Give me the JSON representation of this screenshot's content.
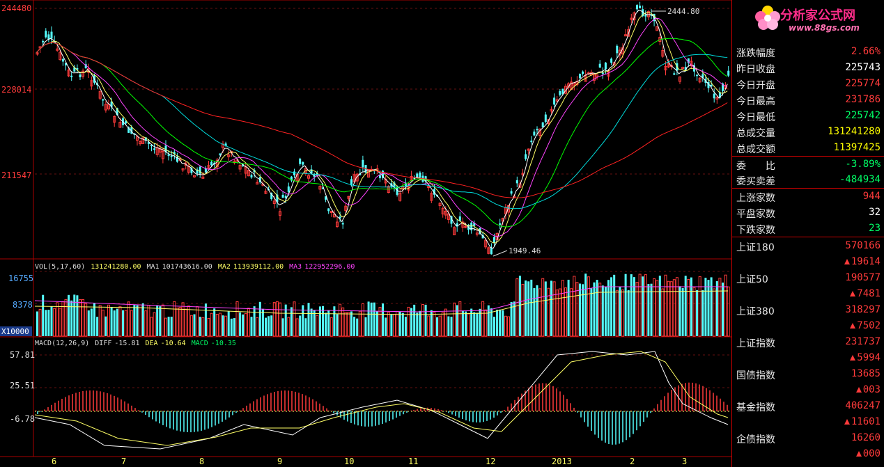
{
  "price_axis": [
    "244480",
    "228014",
    "211547"
  ],
  "vol_axis": [
    "16755",
    "8378",
    "X10000"
  ],
  "macd_axis": [
    "57.81",
    "25.51",
    "-6.78"
  ],
  "x_labels": [
    "6",
    "7",
    "8",
    "9",
    "10",
    "11",
    "12",
    "2013",
    "2",
    "3"
  ],
  "annotations": {
    "high": "2444.80",
    "low": "1949.46"
  },
  "vol_header": {
    "name": "VOL(5,17,60)",
    "vol": "131241280.00",
    "ma1_label": "MA1",
    "ma1": "101743616.00",
    "ma2_label": "MA2",
    "ma2": "113939112.00",
    "ma3_label": "MA3",
    "ma3": "122952296.00"
  },
  "macd_header": {
    "name": "MACD(12,26,9)",
    "diff_label": "DIFF",
    "diff": "-15.81",
    "dea_label": "DEA",
    "dea": "-10.64",
    "macd_label": "MACD",
    "macd": "-10.35"
  },
  "logo": {
    "main": "分析家公式网",
    "sub": "www.88gs.com"
  },
  "quote": [
    {
      "label": "涨跌幅度",
      "value": "2.66%",
      "cls": "up"
    },
    {
      "label": "昨日收盘",
      "value": "225743",
      "cls": "wt"
    },
    {
      "label": "今日开盘",
      "value": "225774",
      "cls": "up"
    },
    {
      "label": "今日最高",
      "value": "231786",
      "cls": "up"
    },
    {
      "label": "今日最低",
      "value": "225742",
      "cls": "dn"
    },
    {
      "label": "总成交量",
      "value": "131241280",
      "cls": "yl"
    },
    {
      "label": "总成交额",
      "value": "11397425",
      "cls": "yl"
    }
  ],
  "order": [
    {
      "label": "委　　比",
      "value": "-3.89%",
      "cls": "dn"
    },
    {
      "label": "委买卖差",
      "value": "-484934",
      "cls": "dn"
    }
  ],
  "breadth": [
    {
      "label": "上涨家数",
      "value": "944",
      "cls": "up"
    },
    {
      "label": "平盘家数",
      "value": "32",
      "cls": "wt"
    },
    {
      "label": "下跌家数",
      "value": "23",
      "cls": "dn"
    }
  ],
  "indices": [
    {
      "label": "上证180",
      "value": "570166",
      "change": "19614"
    },
    {
      "label": "上证50",
      "value": "190577",
      "change": "7481"
    },
    {
      "label": "上证380",
      "value": "318297",
      "change": "7502"
    },
    {
      "label": "上证指数",
      "value": "231737",
      "change": "5994"
    },
    {
      "label": "国债指数",
      "value": "13685",
      "change": "003"
    },
    {
      "label": "基金指数",
      "value": "406247",
      "change": "11601"
    },
    {
      "label": "企债指数",
      "value": "16260",
      "change": "000"
    }
  ],
  "colors": {
    "up": "#ff3b3b",
    "down": "#55ffff",
    "ma5": "#ffffff",
    "ma10": "#ffff66",
    "ma20": "#ff44ff",
    "ma30": "#00ff00",
    "ma60": "#00dddd",
    "ma120": "#ff2222"
  }
}
